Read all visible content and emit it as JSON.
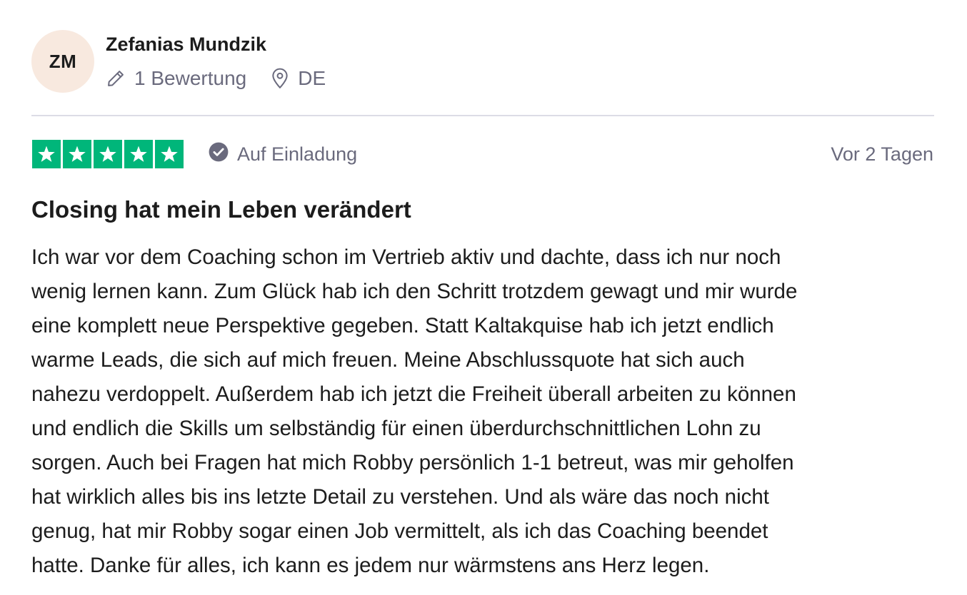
{
  "reviewer": {
    "initials": "ZM",
    "name": "Zefanias Mundzik",
    "review_count": "1 Bewertung",
    "country": "DE"
  },
  "review": {
    "rating": 5,
    "rating_max": 5,
    "star_color": "#00b67a",
    "verification_label": "Auf Einladung",
    "date": "Vor 2 Tagen",
    "title": "Closing hat mein Leben verändert",
    "body_lines": [
      "Ich war vor dem Coaching schon im Vertrieb aktiv und dachte, dass ich nur noch",
      "wenig lernen kann. Zum Glück hab ich den Schritt trotzdem gewagt und mir wurde",
      "eine komplett neue Perspektive gegeben. Statt Kaltakquise hab ich jetzt endlich",
      "warme Leads, die sich auf mich freuen. Meine Abschlussquote hat sich auch",
      "nahezu verdoppelt. Außerdem hab ich jetzt die Freiheit überall arbeiten zu können",
      "und endlich die Skills um selbständig für einen überdurchschnittlichen Lohn zu",
      "sorgen. Auch bei Fragen hat mich Robby persönlich 1-1 betreut, was mir geholfen",
      "hat wirklich alles bis ins letzte Detail zu verstehen. Und als wäre das noch nicht",
      "genug, hat mir Robby sogar einen Job vermittelt, als ich das Coaching beendet",
      "hatte. Danke für alles, ich kann es jedem nur wärmstens ans Herz legen."
    ]
  },
  "icons": {
    "review_count": "pencil-icon",
    "country": "location-pin-icon",
    "verification": "check-circle-icon",
    "rating": "star-icon"
  },
  "colors": {
    "avatar_background": "#f8e9df",
    "muted_text": "#6a6a7d",
    "divider": "#dcdce6"
  }
}
